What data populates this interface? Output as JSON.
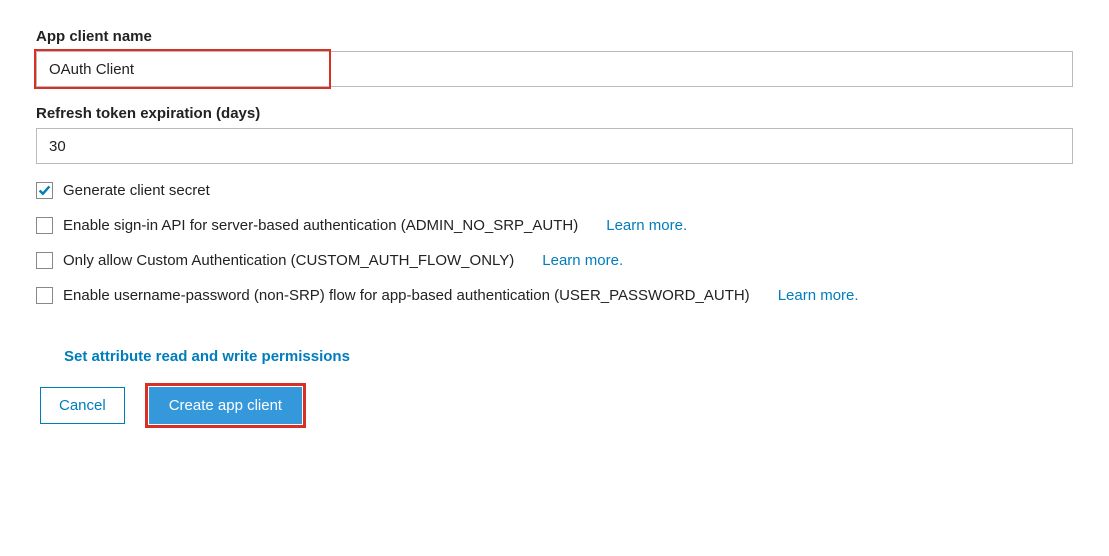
{
  "fields": {
    "app_client_name": {
      "label": "App client name",
      "value": "OAuth Client"
    },
    "refresh_token_expiration": {
      "label": "Refresh token expiration (days)",
      "value": "30"
    }
  },
  "checkboxes": {
    "generate_client_secret": {
      "label": "Generate client secret",
      "checked": true
    },
    "admin_no_srp": {
      "label": "Enable sign-in API for server-based authentication (ADMIN_NO_SRP_AUTH)",
      "checked": false,
      "learn_more": "Learn more."
    },
    "custom_auth_only": {
      "label": "Only allow Custom Authentication (CUSTOM_AUTH_FLOW_ONLY)",
      "checked": false,
      "learn_more": "Learn more."
    },
    "user_password_auth": {
      "label": "Enable username-password (non-SRP) flow for app-based authentication (USER_PASSWORD_AUTH)",
      "checked": false,
      "learn_more": "Learn more."
    }
  },
  "links": {
    "set_permissions": "Set attribute read and write permissions"
  },
  "buttons": {
    "cancel": "Cancel",
    "create": "Create app client"
  }
}
